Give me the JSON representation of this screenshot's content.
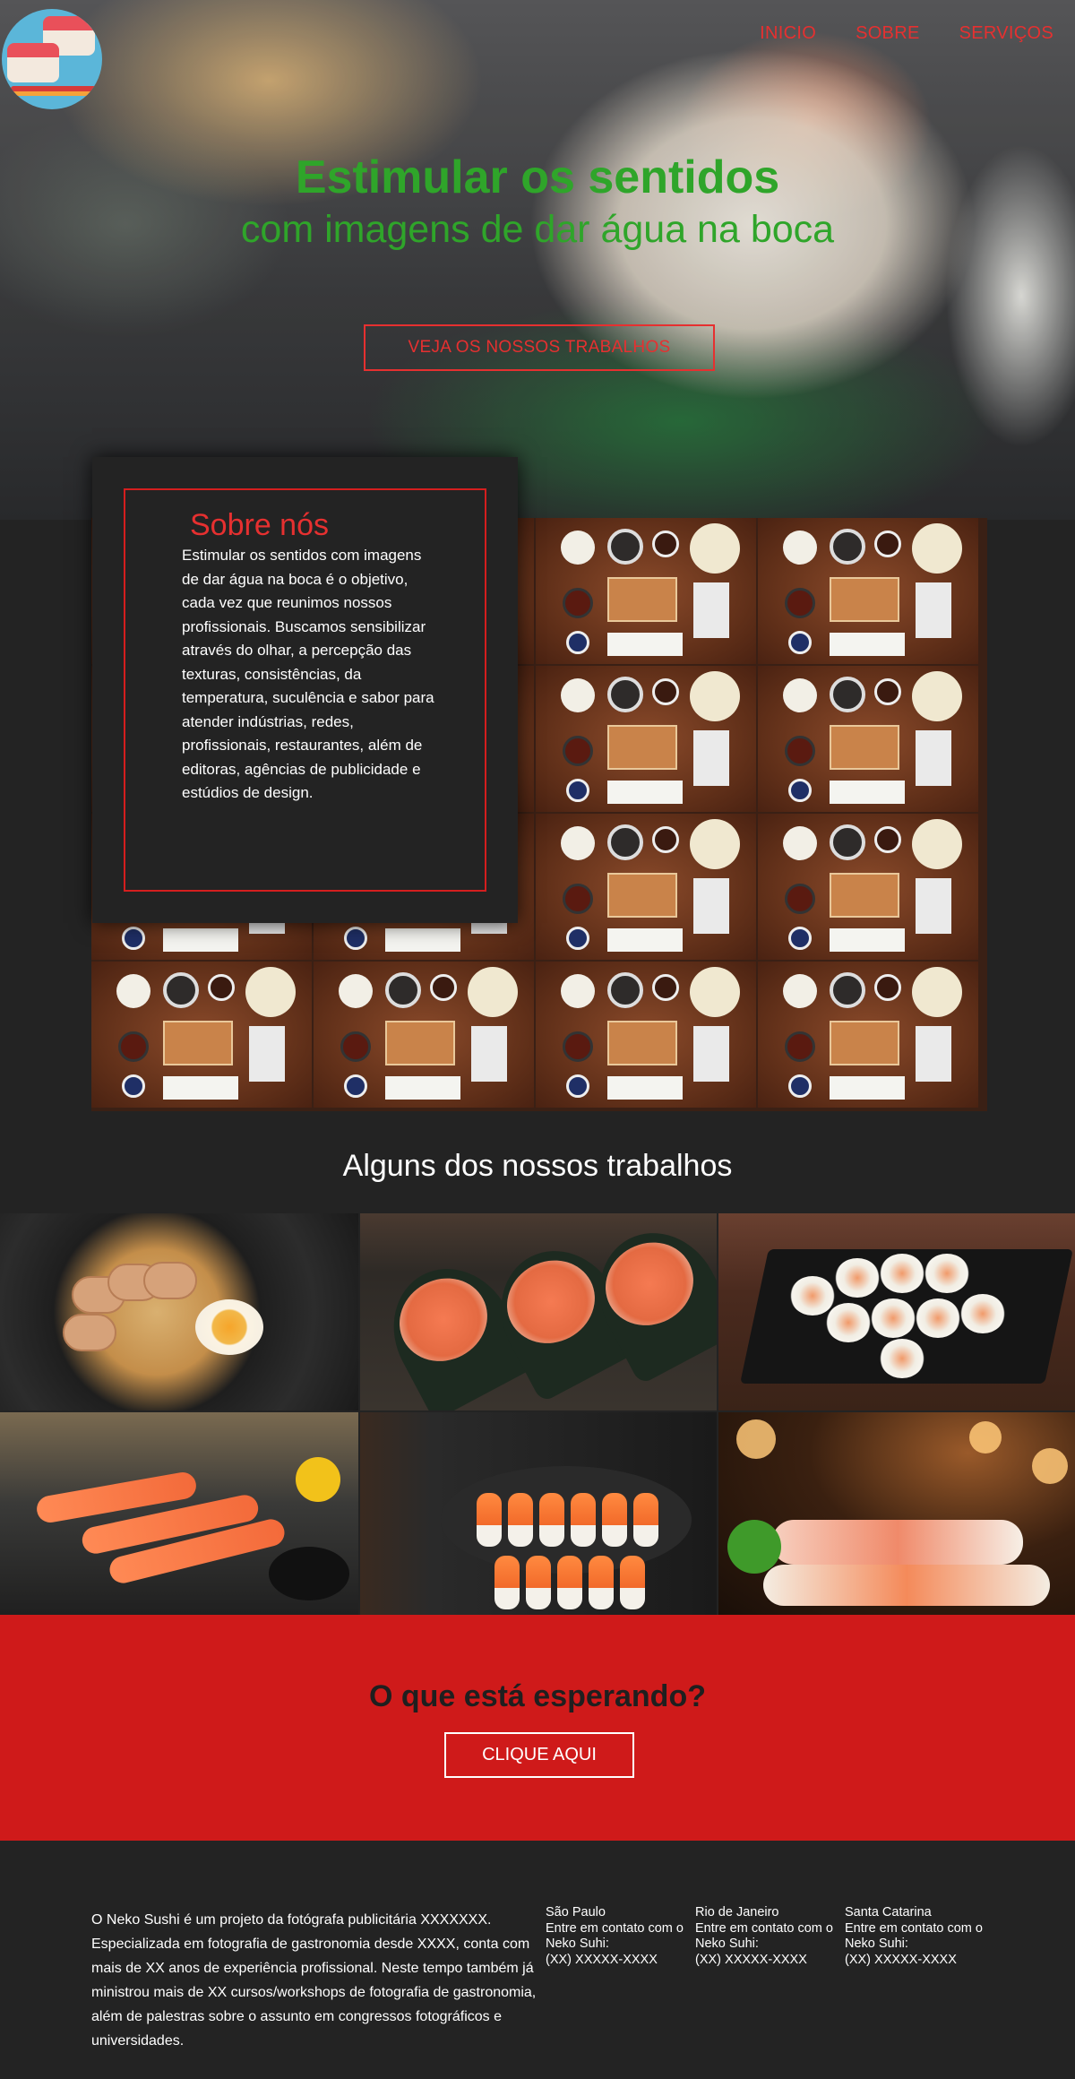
{
  "nav": {
    "items": [
      {
        "label": "INICIO"
      },
      {
        "label": "SOBRE"
      },
      {
        "label": "SERVIÇOS"
      }
    ]
  },
  "hero": {
    "title": "Estimular os sentidos",
    "subtitle": "com imagens de dar água na boca",
    "button_label": "VEJA OS NOSSOS TRABALHOS"
  },
  "about": {
    "title": "Sobre nós",
    "text": "Estimular os sentidos com imagens de dar água na boca é o objetivo, cada vez que reunimos nossos profissionais. Buscamos sensibilizar através do olhar, a percepção das texturas, consistências, da temperatura, suculência e sabor para atender indústrias, redes, profissionais, restaurantes, além de editoras, agências de publicidade e estúdios de design."
  },
  "works": {
    "heading": "Alguns dos nossos trabalhos"
  },
  "cta": {
    "title": "O que está esperando?",
    "button_label": "CLIQUE AQUI"
  },
  "footer": {
    "about": "O Neko Sushi é um projeto da fotógrafa publicitária XXXXXXX. Especializada em fotografia de gastronomia desde XXXX, conta com mais de XX anos de experiência profissional. Neste tempo também já ministrou mais de XX cursos/workshops de fotografia de gastronomia, além de palestras sobre o assunto em congressos fotográficos e universidades.",
    "cities": [
      {
        "name": "São Paulo",
        "contact": "Entre em contato com o Neko Suhi:",
        "phone": "(XX) XXXXX-XXXX"
      },
      {
        "name": "Rio de Janeiro",
        "contact": "Entre em contato com o Neko Suhi:",
        "phone": "(XX) XXXXX-XXXX"
      },
      {
        "name": "Santa Catarina",
        "contact": "Entre em contato com o Neko Suhi:",
        "phone": "(XX) XXXXX-XXXX"
      }
    ]
  },
  "colors": {
    "accent_red": "#e63030",
    "cta_red": "#cf1a1a",
    "hero_green": "#2fa52a",
    "dark_bg": "#232323"
  }
}
